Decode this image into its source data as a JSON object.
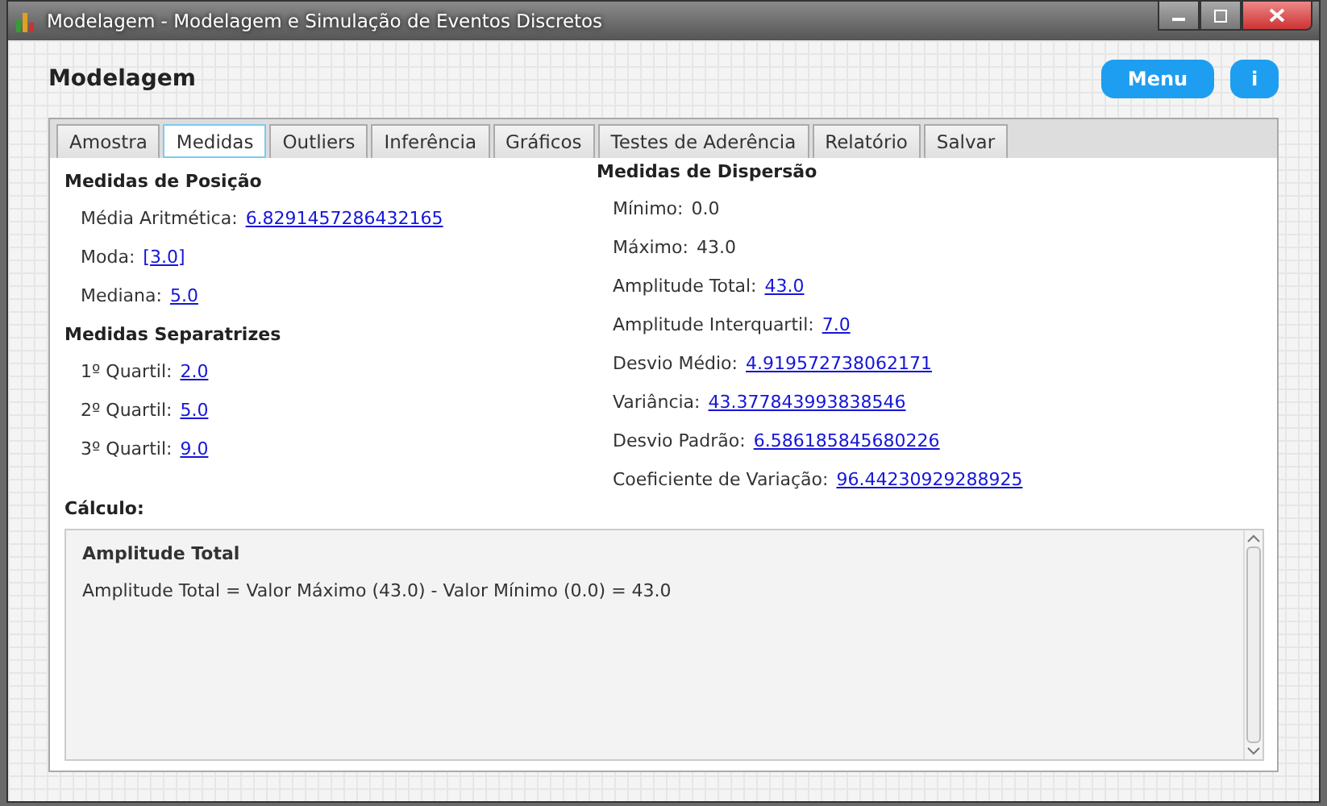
{
  "window": {
    "title": "Modelagem - Modelagem e Simulação de Eventos Discretos"
  },
  "header": {
    "title": "Modelagem",
    "buttons": [
      "Menu",
      "i"
    ]
  },
  "tabs": [
    {
      "label": "Amostra",
      "selected": false
    },
    {
      "label": "Medidas",
      "selected": true
    },
    {
      "label": "Outliers",
      "selected": false
    },
    {
      "label": "Inferência",
      "selected": false
    },
    {
      "label": "Gráficos",
      "selected": false
    },
    {
      "label": "Testes de Aderência",
      "selected": false
    },
    {
      "label": "Relatório",
      "selected": false
    },
    {
      "label": "Salvar",
      "selected": false
    }
  ],
  "left_sections": [
    {
      "title": "Medidas de Posição",
      "items": [
        {
          "label": "Média Aritmética:",
          "value": "6.8291457286432165",
          "kind": "link"
        },
        {
          "label": "Moda:",
          "value": "[3.0]",
          "kind": "link"
        },
        {
          "label": "Mediana:",
          "value": "5.0",
          "kind": "link"
        }
      ]
    },
    {
      "title": "Medidas Separatrizes",
      "items": [
        {
          "label": "1º Quartil:",
          "value": "2.0",
          "kind": "link"
        },
        {
          "label": "2º Quartil:",
          "value": "5.0",
          "kind": "link"
        },
        {
          "label": "3º Quartil:",
          "value": "9.0",
          "kind": "link"
        }
      ]
    }
  ],
  "right_sections": [
    {
      "title": "Medidas de Dispersão",
      "items": [
        {
          "label": "Mínimo:",
          "value": "0.0",
          "kind": "plain"
        },
        {
          "label": "Máximo:",
          "value": "43.0",
          "kind": "plain"
        },
        {
          "label": "Amplitude Total:",
          "value": "43.0",
          "kind": "link"
        },
        {
          "label": "Amplitude Interquartil:",
          "value": "7.0",
          "kind": "link"
        },
        {
          "label": "Desvio Médio:",
          "value": "4.919572738062171",
          "kind": "link"
        },
        {
          "label": "Variância:",
          "value": "43.377843993838546",
          "kind": "link"
        },
        {
          "label": "Desvio Padrão:",
          "value": "6.586185845680226",
          "kind": "link"
        },
        {
          "label": "Coeficiente de Variação:",
          "value": "96.44230929288925",
          "kind": "link"
        }
      ]
    }
  ],
  "calculation": {
    "label": "Cálculo:",
    "title": "Amplitude Total",
    "text": "Amplitude Total = Valor Máximo (43.0) - Valor Mínimo (0.0) = 43.0"
  }
}
